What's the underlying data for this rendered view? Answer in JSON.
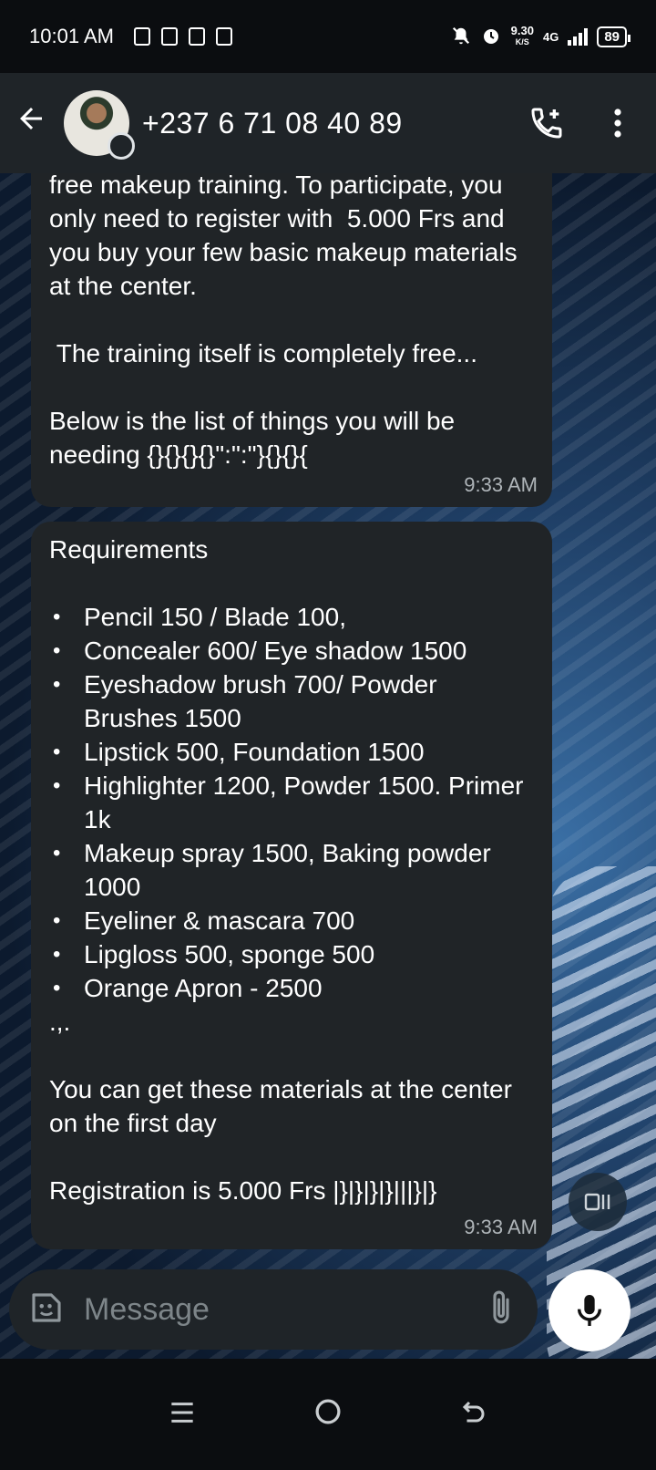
{
  "status_bar": {
    "time": "10:01 AM",
    "net_speed_value": "9.30",
    "net_speed_unit": "K/S",
    "network": "4G",
    "battery": "89"
  },
  "header": {
    "contact": "+237 6 71 08 40 89"
  },
  "messages": [
    {
      "text": "free makeup training. To participate, you only need to register with  5.000 Frs and you buy your few basic makeup materials at the center.\n\n The training itself is completely free...\n\nBelow is the list of things you will be needing {}{}{}{}\":\":\"}{}{}{",
      "time": "9:33 AM"
    },
    {
      "title": "Requirements",
      "items": [
        "Pencil 150 / Blade 100,",
        "Concealer 600/  Eye shadow 1500",
        "Eyeshadow brush 700/ Powder Brushes 1500",
        "Lipstick 500, Foundation 1500",
        "Highlighter 1200, Powder 1500. Primer 1k",
        "Makeup spray 1500, Baking powder 1000",
        "Eyeliner & mascara  700",
        "Lipgloss 500, sponge 500",
        "Orange Apron - 2500"
      ],
      "after_list": ".,.",
      "para1": "You can get these materials at the center on the first day",
      "para2": "Registration is 5.000 Frs |}|}|}|}|||}|}",
      "time": "9:33 AM"
    }
  ],
  "composer": {
    "placeholder": "Message"
  },
  "colors": {
    "bubble": "#202427",
    "header": "#1f2428",
    "timestamp": "#aeb4b8"
  },
  "icons": [
    "back-arrow-icon",
    "add-call-icon",
    "more-vert-icon",
    "sticker-icon",
    "attach-icon",
    "camera-icon",
    "mic-icon",
    "recent-apps-icon",
    "home-icon",
    "back-icon"
  ]
}
